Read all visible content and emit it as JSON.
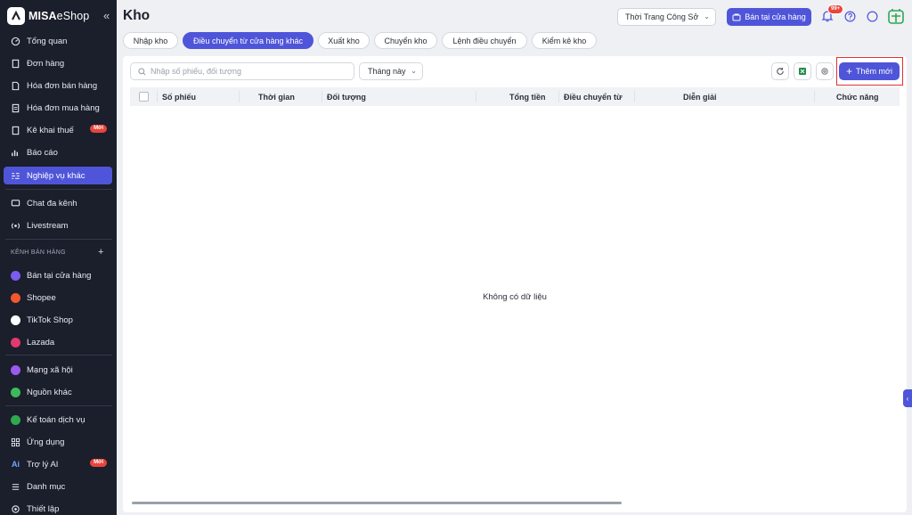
{
  "brand": {
    "name": "MISA",
    "suffix": "eShop"
  },
  "sidebar": {
    "collapse_glyph": "«",
    "items": [
      {
        "label": "Tổng quan",
        "icon": "dashboard-icon"
      },
      {
        "label": "Đơn hàng",
        "icon": "order-icon"
      },
      {
        "label": "Hóa đơn bán hàng",
        "icon": "sales-invoice-icon"
      },
      {
        "label": "Hóa đơn mua hàng",
        "icon": "purchase-invoice-icon"
      },
      {
        "label": "Kê khai thuế",
        "icon": "tax-icon",
        "badge": "Mới"
      },
      {
        "label": "Báo cáo",
        "icon": "report-icon"
      },
      {
        "label": "Nghiệp vụ khác",
        "icon": "operations-icon",
        "active": true
      },
      {
        "label": "Chat đa kênh",
        "icon": "chat-icon"
      },
      {
        "label": "Livestream",
        "icon": "livestream-icon"
      }
    ],
    "channels_header": "KÊNH BÁN HÀNG",
    "channels_add": "+",
    "channels": [
      {
        "label": "Bán tại cửa hàng",
        "color": "#7b5cf0"
      },
      {
        "label": "Shopee",
        "color": "#f0582d"
      },
      {
        "label": "TikTok Shop",
        "color": "#ffffff"
      },
      {
        "label": "Lazada",
        "color": "#e2396e"
      }
    ],
    "more": [
      {
        "label": "Mạng xã hội",
        "color": "#9b59f0"
      },
      {
        "label": "Nguồn khác",
        "color": "#3dbb5a"
      }
    ],
    "bottom": [
      {
        "label": "Kế toán dịch vụ",
        "icon": "accounting-icon"
      },
      {
        "label": "Ứng dụng",
        "icon": "apps-icon"
      },
      {
        "label": "Trợ lý AI",
        "icon": "ai-icon",
        "prefix": "Ai",
        "badge": "Mới"
      },
      {
        "label": "Danh mục",
        "icon": "list-icon"
      },
      {
        "label": "Thiết lập",
        "icon": "settings-icon"
      }
    ]
  },
  "header": {
    "title": "Kho",
    "store": "Thời Trang Công Sở",
    "sell_button": "Bán tại cửa hàng",
    "notifications": "99+"
  },
  "tabs": [
    {
      "label": "Nhập kho"
    },
    {
      "label": "Điều chuyển từ cửa hàng khác",
      "active": true
    },
    {
      "label": "Xuất kho"
    },
    {
      "label": "Chuyển kho"
    },
    {
      "label": "Lệnh điều chuyển"
    },
    {
      "label": "Kiểm kê kho"
    }
  ],
  "toolbar": {
    "search_placeholder": "Nhập số phiếu, đối tượng",
    "period": "Tháng này",
    "add_button": "Thêm mới"
  },
  "table": {
    "columns": [
      "Số phiếu",
      "Thời gian",
      "Đối tượng",
      "Tổng tiền",
      "Điều chuyển từ",
      "Diễn giải",
      "Chức năng"
    ],
    "rows": [],
    "empty_text": "Không có dữ liệu"
  },
  "colors": {
    "accent": "#4f55d9",
    "sidebar_bg": "#1b1e2b",
    "badge": "#e8453c"
  }
}
